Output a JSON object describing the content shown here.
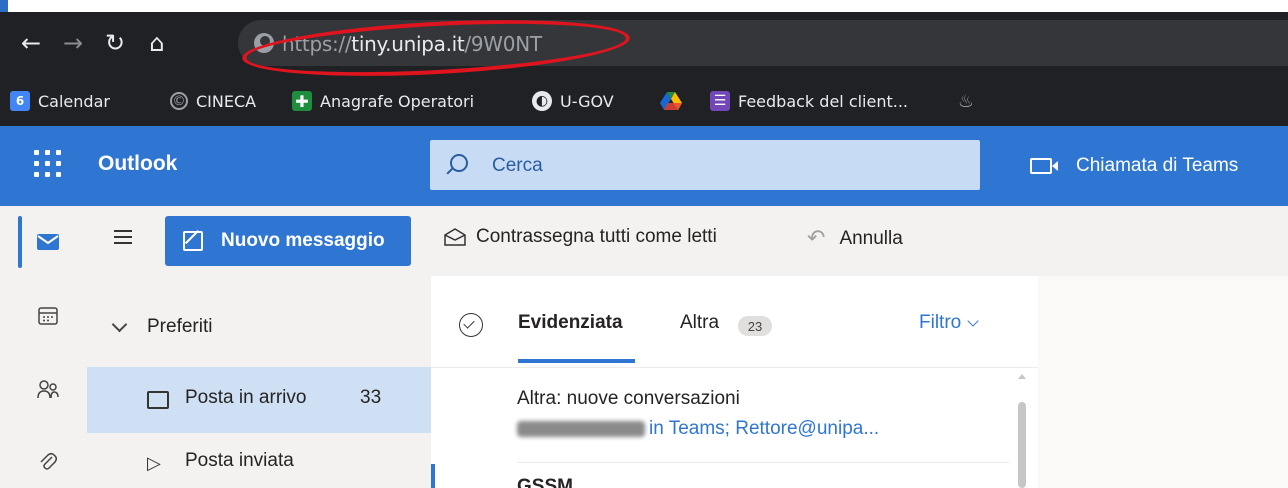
{
  "browser": {
    "url_scheme": "https://",
    "url_host": "tiny.unipa.it",
    "url_path": "/9W0NT",
    "bookmarks": [
      {
        "label": "Calendar",
        "icon": "calendar-icon",
        "color": "#4285f4"
      },
      {
        "label": "CINECA",
        "icon": "cineca-icon",
        "color": "#9aa0a6"
      },
      {
        "label": "Anagrafe Operatori",
        "icon": "cross-icon",
        "color": "#1e8e3e"
      },
      {
        "label": "U-GOV",
        "icon": "globe-icon",
        "color": "#e8eaed"
      },
      {
        "label": "",
        "icon": "drive-icon",
        "color": "#fbbc04"
      },
      {
        "label": "Feedback del client...",
        "icon": "forms-icon",
        "color": "#7248b9"
      },
      {
        "label": "",
        "icon": "extension-icon",
        "color": "#9aa0a6"
      }
    ]
  },
  "outlook": {
    "app_name": "Outlook",
    "search_placeholder": "Cerca",
    "teams_call": "Chiamata di Teams",
    "accent": "#2f76d2",
    "new_message": "Nuovo messaggio",
    "mark_all_read": "Contrassegna tutti come letti",
    "undo": "Annulla",
    "favorites": "Preferiti",
    "inbox_label": "Posta in arrivo",
    "inbox_count": "33",
    "sent_label": "Posta inviata",
    "tab_focused": "Evidenziata",
    "tab_other": "Altra",
    "other_count": "23",
    "filter": "Filtro",
    "message": {
      "title": "Altra: nuove conversazioni",
      "subtitle": "in Teams; Rettore@unipa..."
    },
    "next_item_peek": "GSSM"
  }
}
